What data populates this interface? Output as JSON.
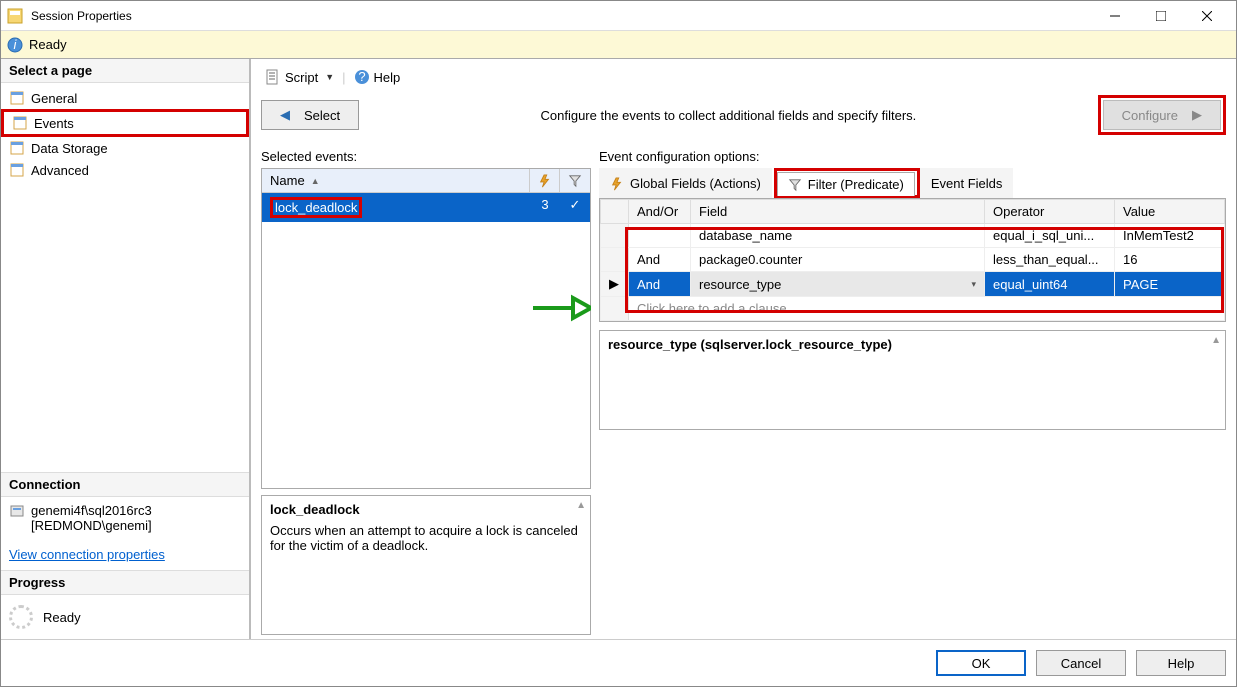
{
  "window": {
    "title": "Session Properties"
  },
  "status": {
    "ready": "Ready"
  },
  "sidebar": {
    "select_page": "Select a page",
    "pages": [
      {
        "label": "General"
      },
      {
        "label": "Events"
      },
      {
        "label": "Data Storage"
      },
      {
        "label": "Advanced"
      }
    ],
    "connection_hdr": "Connection",
    "connection_line1": "genemi4f\\sql2016rc3",
    "connection_line2": "[REDMOND\\genemi]",
    "view_conn_link": "View connection properties",
    "progress_hdr": "Progress",
    "progress_status": "Ready"
  },
  "toolbar": {
    "script": "Script",
    "help": "Help"
  },
  "nav": {
    "select": "Select",
    "configure": "Configure",
    "instruction": "Configure the events to collect additional fields and specify filters."
  },
  "selected_events": {
    "label": "Selected events:",
    "col_name": "Name",
    "rows": [
      {
        "name": "lock_deadlock",
        "count": "3",
        "checked": true
      }
    ]
  },
  "event_desc": {
    "title": "lock_deadlock",
    "body": "Occurs when an attempt to acquire a lock is canceled for the victim of a deadlock."
  },
  "config": {
    "label": "Event configuration options:",
    "tabs": {
      "global": "Global Fields (Actions)",
      "filter": "Filter (Predicate)",
      "fields": "Event Fields"
    },
    "filter_cols": {
      "andor": "And/Or",
      "field": "Field",
      "operator": "Operator",
      "value": "Value"
    },
    "filter_rows": [
      {
        "andor": "",
        "field": "database_name",
        "operator": "equal_i_sql_uni...",
        "value": "InMemTest2"
      },
      {
        "andor": "And",
        "field": "package0.counter",
        "operator": "less_than_equal...",
        "value": "16"
      },
      {
        "andor": "And",
        "field": "resource_type",
        "operator": "equal_uint64",
        "value": "PAGE"
      }
    ],
    "add_clause": "Click here to add a clause",
    "preview": "resource_type (sqlserver.lock_resource_type)"
  },
  "footer": {
    "ok": "OK",
    "cancel": "Cancel",
    "help": "Help"
  }
}
